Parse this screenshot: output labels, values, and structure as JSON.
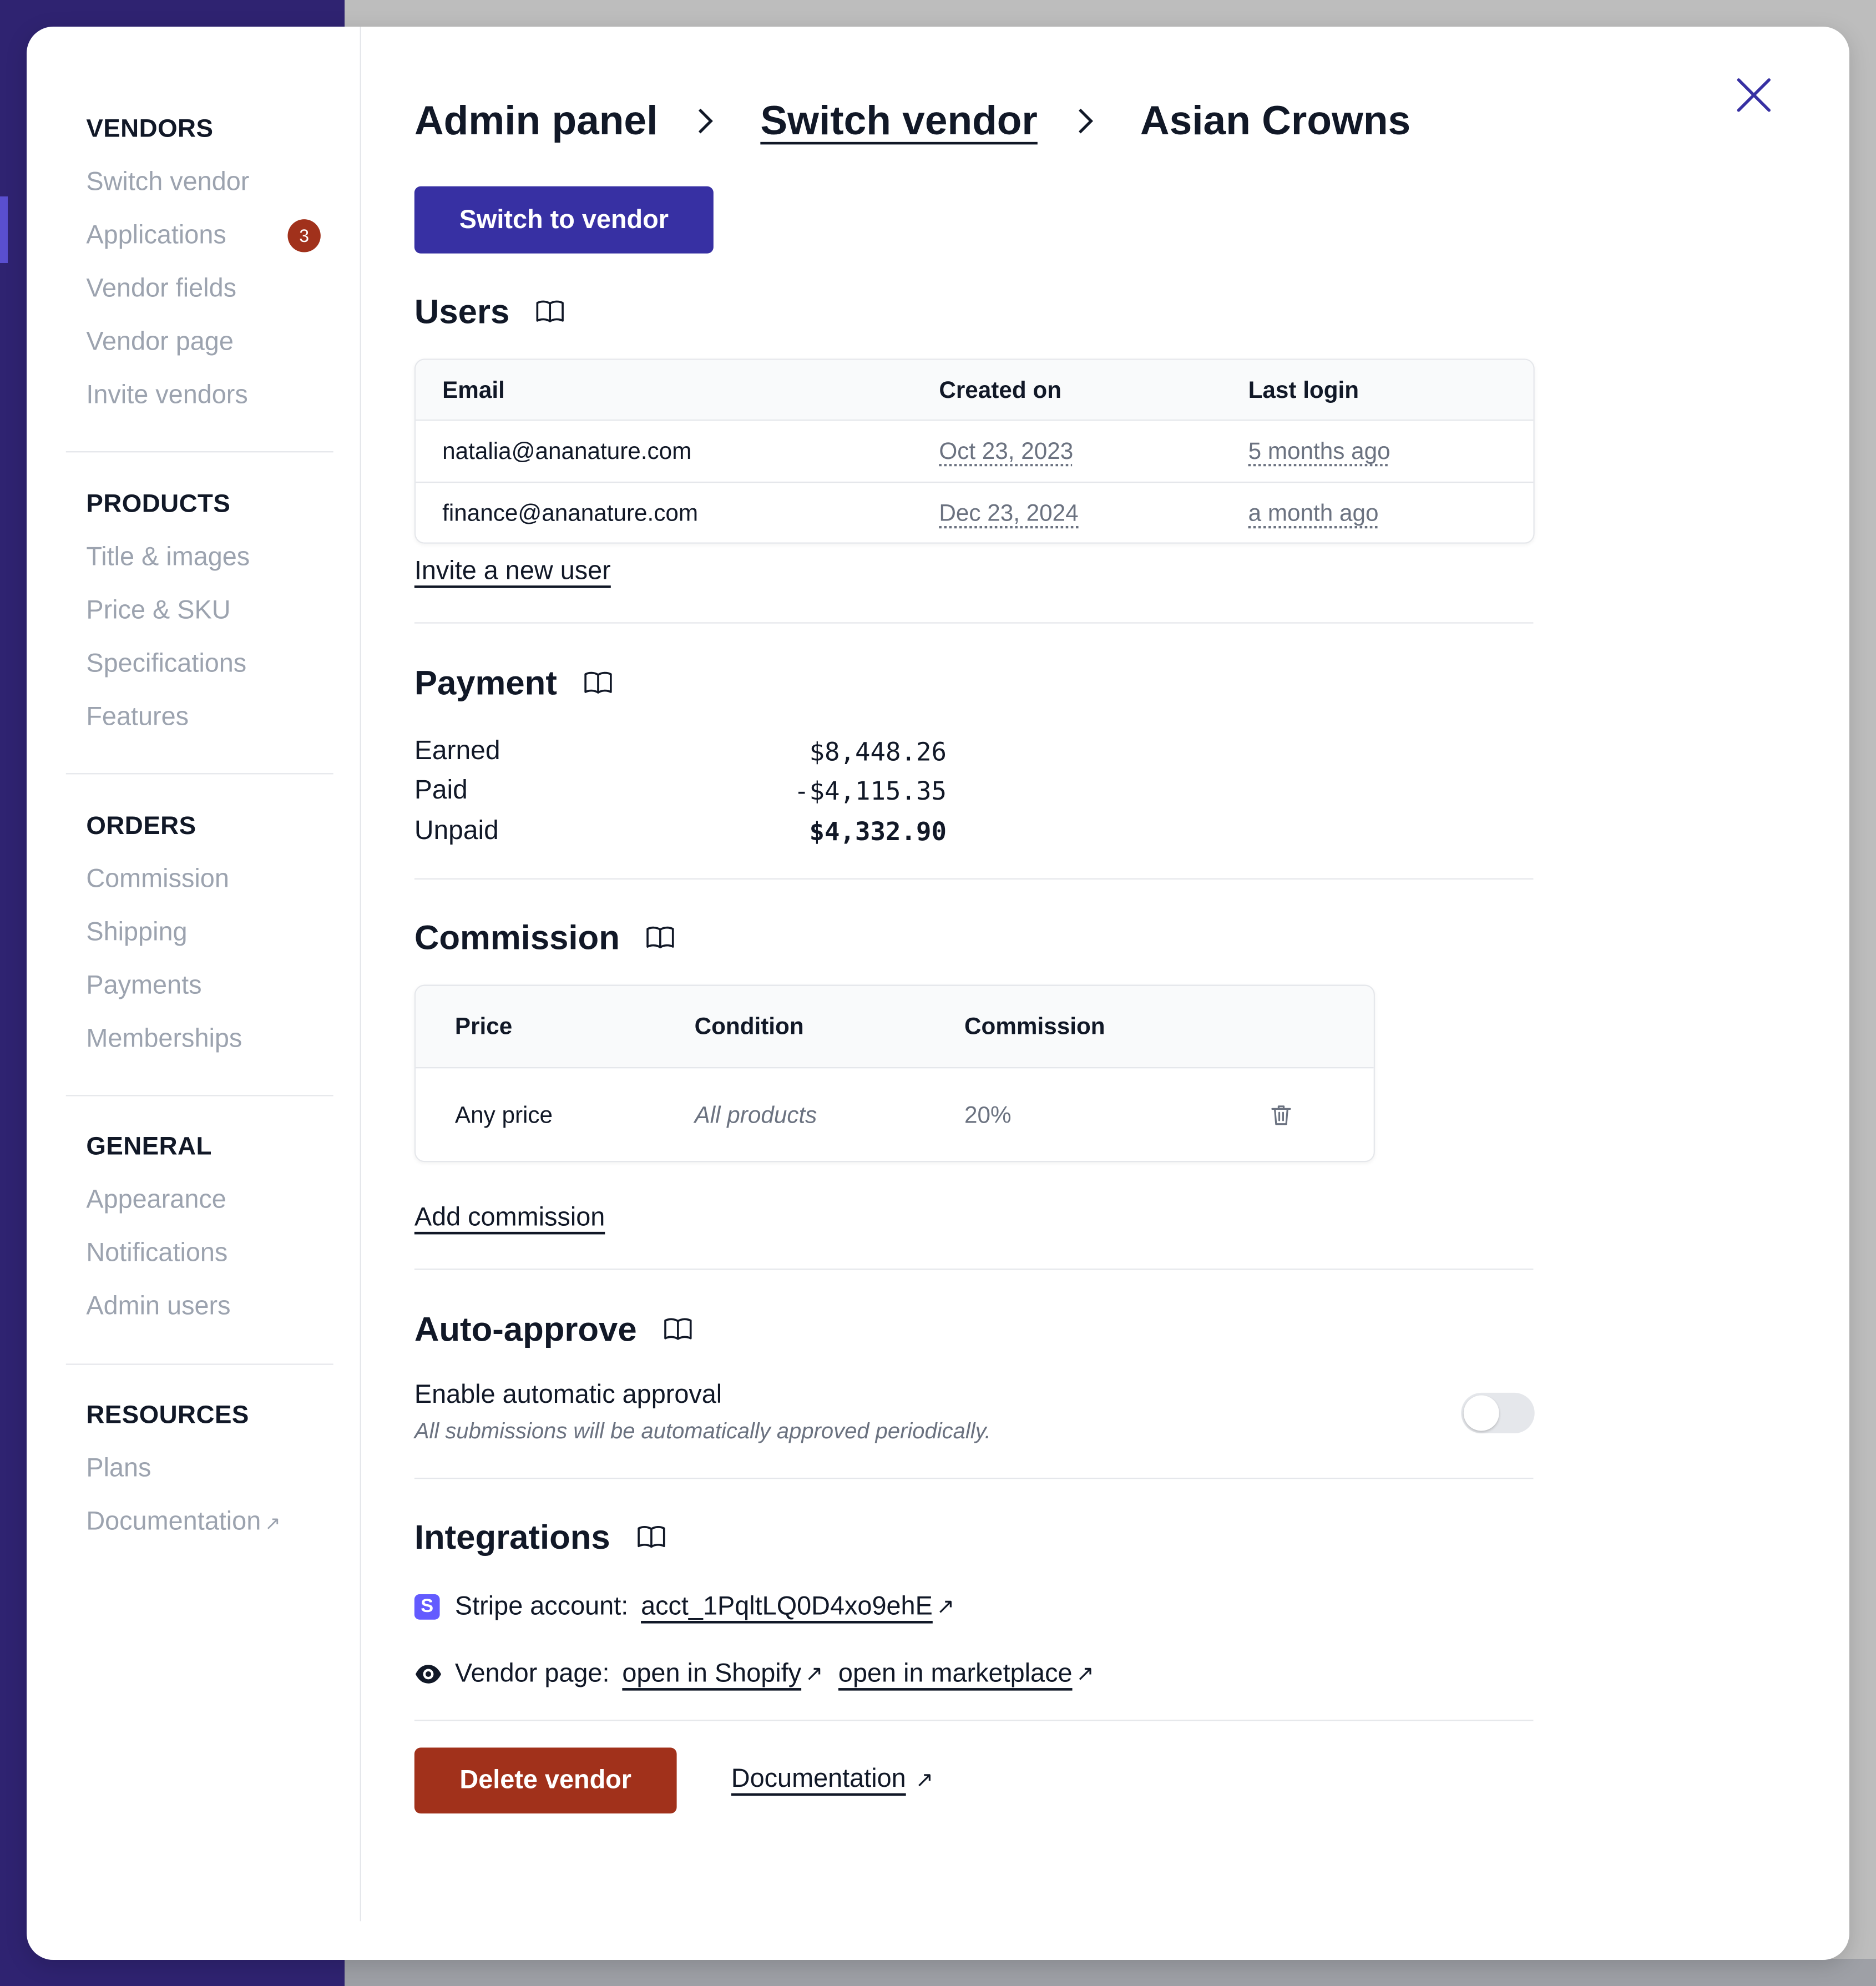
{
  "sidebar": {
    "sections": [
      {
        "title": "VENDORS",
        "items": [
          {
            "label": "Switch vendor"
          },
          {
            "label": "Applications",
            "badge": "3"
          },
          {
            "label": "Vendor fields"
          },
          {
            "label": "Vendor page"
          },
          {
            "label": "Invite vendors"
          }
        ]
      },
      {
        "title": "PRODUCTS",
        "items": [
          {
            "label": "Title & images"
          },
          {
            "label": "Price & SKU"
          },
          {
            "label": "Specifications"
          },
          {
            "label": "Features"
          }
        ]
      },
      {
        "title": "ORDERS",
        "items": [
          {
            "label": "Commission"
          },
          {
            "label": "Shipping"
          },
          {
            "label": "Payments"
          },
          {
            "label": "Memberships"
          }
        ]
      },
      {
        "title": "GENERAL",
        "items": [
          {
            "label": "Appearance"
          },
          {
            "label": "Notifications"
          },
          {
            "label": "Admin users"
          }
        ]
      },
      {
        "title": "RESOURCES",
        "items": [
          {
            "label": "Plans"
          },
          {
            "label": "Documentation",
            "external": "↗"
          }
        ]
      }
    ]
  },
  "breadcrumb": {
    "items": [
      "Admin panel",
      "Switch vendor",
      "Asian Crowns"
    ]
  },
  "actions": {
    "switch_label": "Switch to vendor"
  },
  "users": {
    "heading": "Users",
    "columns": [
      "Email",
      "Created on",
      "Last login"
    ],
    "rows": [
      {
        "email": "natalia@ananature.com",
        "created": "Oct 23, 2023",
        "last_login": "5 months ago"
      },
      {
        "email": "finance@ananature.com",
        "created": "Dec 23, 2024",
        "last_login": "a month ago"
      }
    ],
    "invite_label": "Invite a new user"
  },
  "payment": {
    "heading": "Payment",
    "rows": [
      {
        "label": "Earned",
        "value": "$8,448.26"
      },
      {
        "label": "Paid",
        "value": "-$4,115.35"
      },
      {
        "label": "Unpaid",
        "value": "$4,332.90"
      }
    ]
  },
  "commission": {
    "heading": "Commission",
    "columns": [
      "Price",
      "Condition",
      "Commission"
    ],
    "rows": [
      {
        "price": "Any price",
        "condition": "All products",
        "commission": "20%"
      }
    ],
    "add_label": "Add commission"
  },
  "auto_approve": {
    "heading": "Auto-approve",
    "label": "Enable automatic approval",
    "description": "All submissions will be automatically approved periodically.",
    "enabled": false
  },
  "integrations": {
    "heading": "Integrations",
    "stripe_icon_letter": "S",
    "stripe_label": "Stripe account:",
    "stripe_account": "acct_1PqltLQ0D4xo9ehE",
    "vendor_page_label": "Vendor page:",
    "shopify_link": "open in Shopify",
    "marketplace_link": "open in marketplace",
    "external": "↗"
  },
  "footer": {
    "delete_label": "Delete vendor",
    "docs_label": "Documentation",
    "external": "↗"
  },
  "colors": {
    "primary": "#3730a3",
    "danger": "#a1311b",
    "backdrop_nav": "#2f2371",
    "stripe": "#635bff"
  },
  "icons": [
    "close-icon",
    "chevron-right-icon",
    "book-open-icon",
    "trash-icon",
    "eye-icon",
    "stripe-icon",
    "external-link-icon"
  ]
}
